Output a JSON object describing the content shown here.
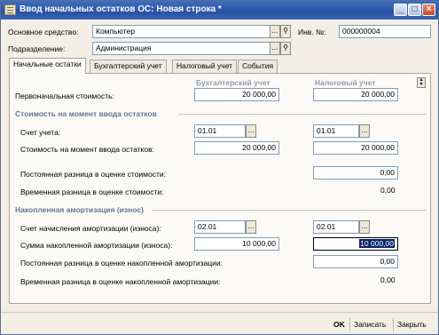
{
  "window": {
    "title": "Ввод начальных остатков ОС: Новая строка *"
  },
  "header": {
    "asset_label": "Основное средство:",
    "asset_value": "Компьютер",
    "inv_label": "Инв. №:",
    "inv_value": "000000004",
    "division_label": "Подразделение:",
    "division_value": "Администрация"
  },
  "tabs": [
    "Начальные остатки",
    "Бухгалтерский учет",
    "Налоговый учет",
    "События"
  ],
  "columns": {
    "accounting": "Бухгалтерский учет",
    "tax": "Налоговый учет"
  },
  "fields": {
    "initial_cost_label": "Первоначальная стоимость:",
    "initial_cost_acc": "20 000,00",
    "initial_cost_tax": "20 000,00",
    "section1_title": "Стоимость на момент ввода остатков",
    "account_label": "Счет учета:",
    "account_acc": "01.01",
    "account_tax": "01.01",
    "cost_at_entry_label": "Стоимость на момент ввода остатков:",
    "cost_at_entry_acc": "20 000,00",
    "cost_at_entry_tax": "20 000,00",
    "perm_diff_cost_label": "Постоянная разница в оценке стоимости:",
    "perm_diff_cost_tax": "0,00",
    "temp_diff_cost_label": "Временная разница в оценке стоимости:",
    "temp_diff_cost_tax": "0,00",
    "section2_title": "Накопленная амортизация (износ)",
    "depr_account_label": "Счет начисления амортизации (износа):",
    "depr_account_acc": "02.01",
    "depr_account_tax": "02.01",
    "accum_depr_label": "Сумма накопленной амортизации (износа):",
    "accum_depr_acc": "10 000,00",
    "accum_depr_tax": "10 000,00",
    "perm_diff_depr_label": "Постоянная разница в оценке накопленной амортизации:",
    "perm_diff_depr_tax": "0,00",
    "temp_diff_depr_label": "Временная разница в оценке накопленной амортизации:",
    "temp_diff_depr_tax": "0,00"
  },
  "buttons": {
    "select": "...",
    "ok": "OK",
    "save": "Записать",
    "close": "Закрыть"
  }
}
